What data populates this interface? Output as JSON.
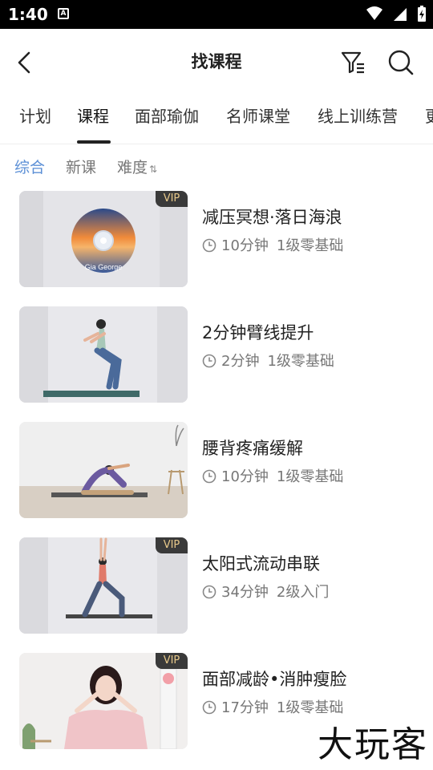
{
  "status": {
    "time": "1:40",
    "notification_badge": "A"
  },
  "header": {
    "title": "找课程"
  },
  "tabs": [
    {
      "label": "计划",
      "active": false
    },
    {
      "label": "课程",
      "active": true
    },
    {
      "label": "面部瑜伽",
      "active": false
    },
    {
      "label": "名师课堂",
      "active": false
    },
    {
      "label": "线上训练营",
      "active": false
    }
  ],
  "sort": {
    "overall": "综合",
    "new": "新课",
    "difficulty": "难度",
    "difficulty_arrows": "⇅",
    "active_color": "#5b8fd6"
  },
  "courses": [
    {
      "title": "减压冥想·落日海浪",
      "duration": "10分钟",
      "level": "1级零基础",
      "vip": "VIP",
      "disc_label": "Gia George"
    },
    {
      "title": "2分钟臂线提升",
      "duration": "2分钟",
      "level": "1级零基础",
      "vip": ""
    },
    {
      "title": "腰背疼痛缓解",
      "duration": "10分钟",
      "level": "1级零基础",
      "vip": ""
    },
    {
      "title": "太阳式流动串联",
      "duration": "34分钟",
      "level": "2级入门",
      "vip": "VIP"
    },
    {
      "title": "面部减龄•消肿瘦脸",
      "duration": "17分钟",
      "level": "1级零基础",
      "vip": "VIP"
    }
  ],
  "watermark": "大玩客"
}
